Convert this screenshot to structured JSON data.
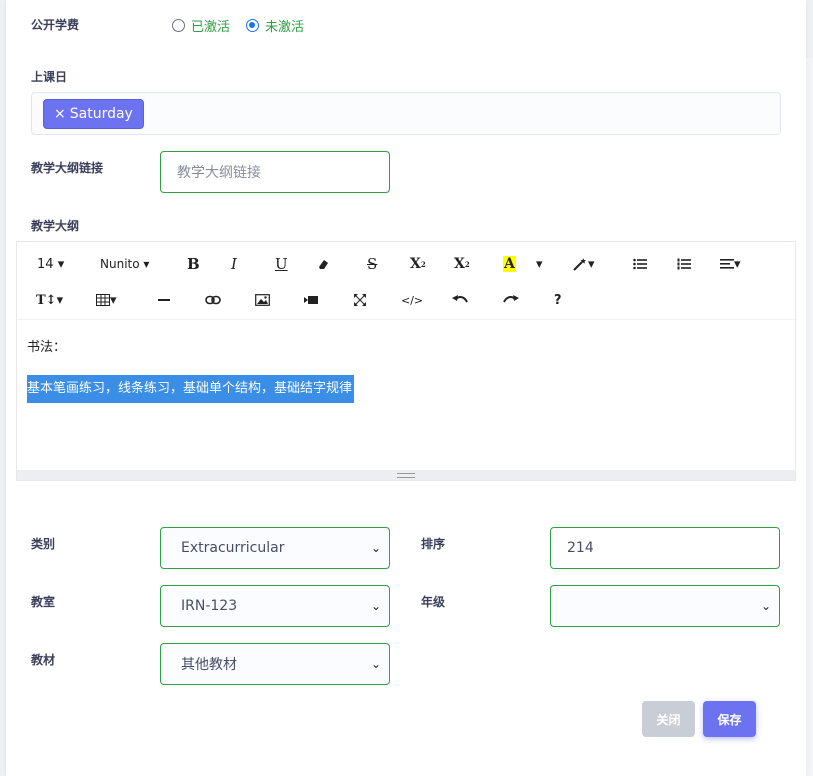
{
  "fee": {
    "label": "公开学费",
    "options": [
      {
        "label": "已激活",
        "checked": false
      },
      {
        "label": "未激活",
        "checked": true
      }
    ]
  },
  "class_day": {
    "label": "上课日",
    "tags": [
      {
        "remove": "×",
        "label": "Saturday"
      }
    ]
  },
  "syllabus_link": {
    "label": "教学大纲链接",
    "placeholder": "教学大纲链接"
  },
  "syllabus": {
    "label": "教学大纲",
    "toolbar": {
      "font_size": "14",
      "font_name": "Nunito",
      "bold": "B",
      "italic": "I",
      "underline": "U",
      "strike": "S",
      "superscript": "X",
      "subscript": "X",
      "color": "A",
      "help": "?"
    },
    "content_line1": "书法：",
    "content_line2": "基本笔画练习，线条练习，基础单个结构，基础结字规律"
  },
  "category": {
    "label": "类别",
    "value": "Extracurricular"
  },
  "order": {
    "label": "排序",
    "value": "214"
  },
  "classroom": {
    "label": "教室",
    "value": "IRN-123"
  },
  "grade": {
    "label": "年级",
    "value": ""
  },
  "textbook": {
    "label": "教材",
    "value": "其他教材"
  },
  "buttons": {
    "close": "关闭",
    "save": "保存"
  },
  "colors": {
    "accent": "#6c72f0",
    "valid_border": "#2f9e44",
    "highlight": "#3a8ee6"
  }
}
